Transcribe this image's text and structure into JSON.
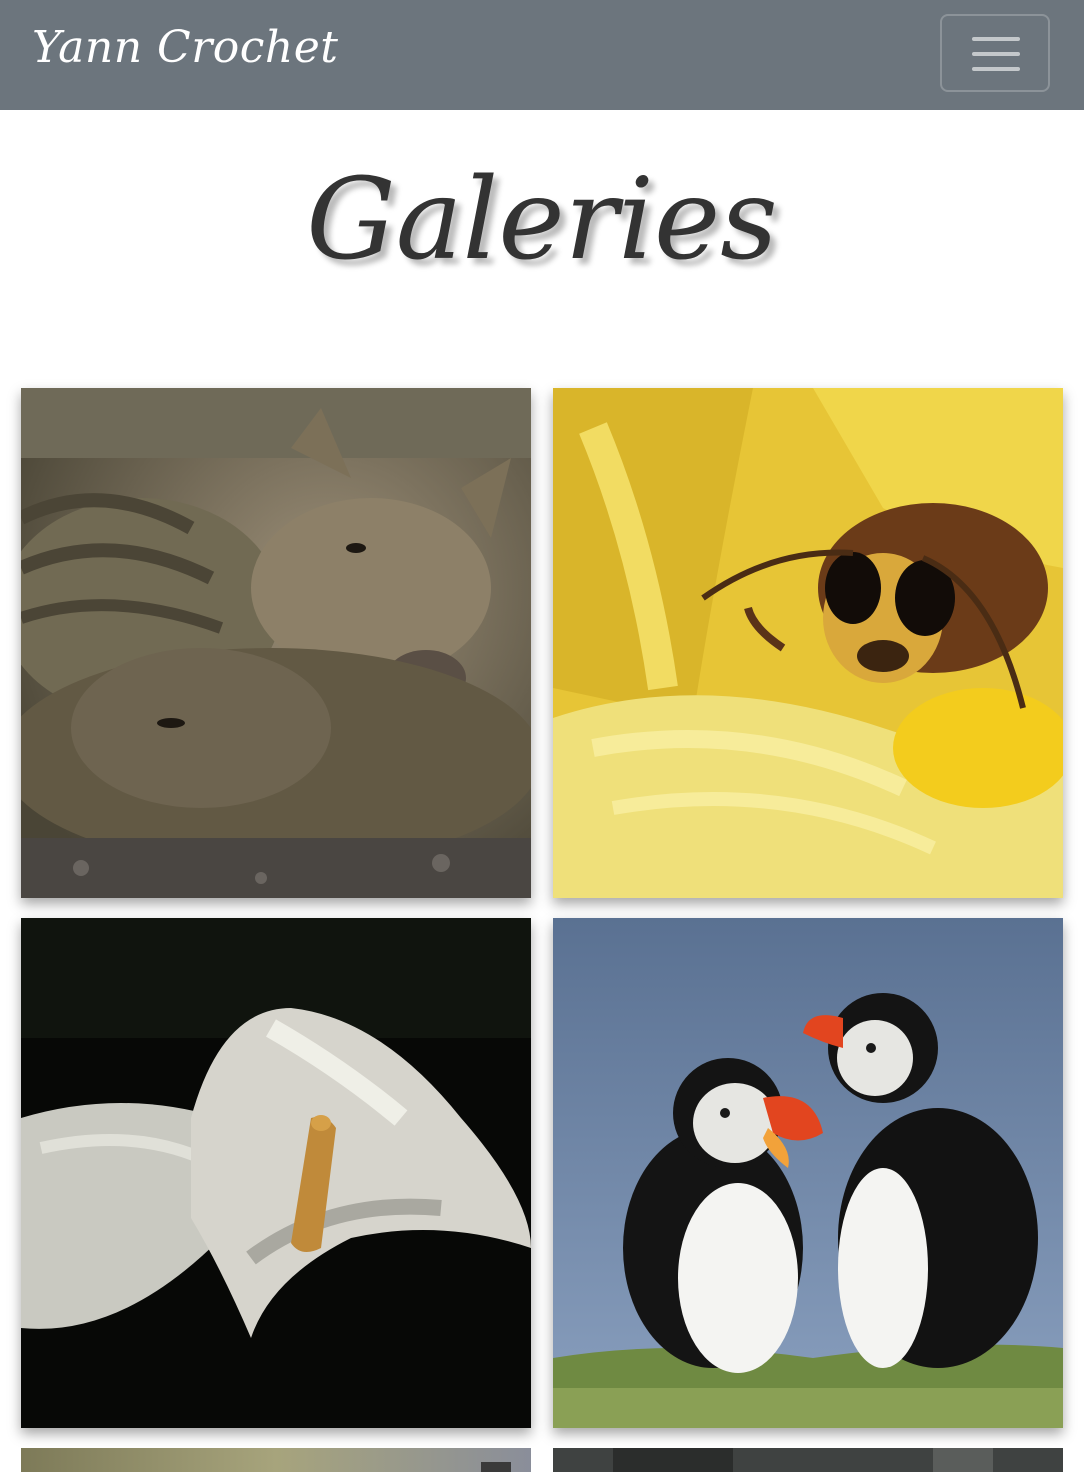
{
  "navbar": {
    "brand": "Yann Crochet",
    "background_color": "#6c757d",
    "menu_icon": "hamburger-icon"
  },
  "page": {
    "title": "Galeries",
    "title_color": "#333333"
  },
  "gallery": {
    "items": [
      {
        "subject": "wild boar piglets"
      },
      {
        "subject": "hornet on yellow iris"
      },
      {
        "subject": "white calla lily"
      },
      {
        "subject": "atlantic puffins"
      },
      {
        "subject": "partially visible photo"
      },
      {
        "subject": "partially visible photo"
      }
    ]
  }
}
